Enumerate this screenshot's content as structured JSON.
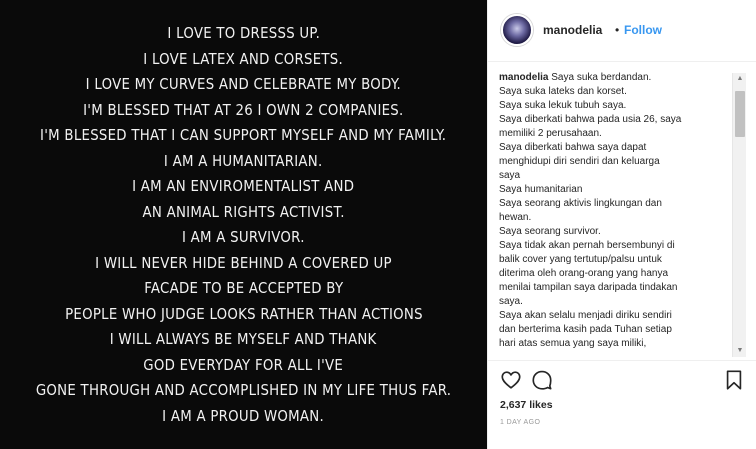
{
  "post": {
    "quote_lines": [
      "I LOVE TO DRESSS UP.",
      "I LOVE LATEX AND CORSETS.",
      "I LOVE MY CURVES AND CELEBRATE MY BODY.",
      "I'M BLESSED THAT AT 26 I OWN 2 COMPANIES.",
      "I'M BLESSED THAT I CAN SUPPORT MYSELF AND MY FAMILY.",
      "I AM A HUMANITARIAN.",
      "I AM AN ENVIROMENTALIST AND",
      "AN ANIMAL RIGHTS ACTIVIST.",
      "I AM A SURVIVOR.",
      "I WILL NEVER HIDE BEHIND A COVERED UP",
      "FACADE TO BE ACCEPTED BY",
      "PEOPLE WHO JUDGE LOOKS RATHER THAN ACTIONS",
      "I WILL ALWAYS BE MYSELF AND THANK",
      "GOD EVERYDAY FOR ALL I'VE",
      "GONE THROUGH AND ACCOMPLISHED IN MY LIFE THUS FAR.",
      "I AM A PROUD WOMAN."
    ]
  },
  "header": {
    "username": "manodelia",
    "separator": "•",
    "follow_label": "Follow"
  },
  "caption": {
    "username": "manodelia",
    "first_line_text": " Saya suka berdandan.",
    "lines": [
      "Saya suka lateks dan korset.",
      "Saya suka lekuk tubuh saya.",
      "Saya diberkati bahwa pada usia 26, saya",
      "memiliki 2 perusahaan.",
      "Saya diberkati bahwa saya dapat",
      "menghidupi diri sendiri dan keluarga",
      "saya",
      "Saya humanitarian",
      "Saya seorang aktivis lingkungan dan",
      "hewan.",
      "Saya seorang survivor.",
      "Saya tidak akan pernah bersembunyi di",
      "balik cover yang tertutup/palsu untuk",
      "diterima oleh orang-orang yang hanya",
      "menilai tampilan saya daripada tindakan",
      "saya.",
      "Saya akan selalu menjadi diriku sendiri",
      "dan berterima kasih pada Tuhan setiap",
      "hari atas semua yang saya miliki,"
    ]
  },
  "scrollbar": {
    "up_arrow": "▲",
    "down_arrow": "▼"
  },
  "actions": {
    "like_icon": "heart-icon",
    "comment_icon": "comment-icon",
    "save_icon": "bookmark-icon"
  },
  "stats": {
    "likes": "2,637 likes",
    "timestamp": "1 DAY AGO"
  },
  "colors": {
    "accent": "#3897f0",
    "image_bg": "#0a0a0a",
    "text": "#262626"
  }
}
